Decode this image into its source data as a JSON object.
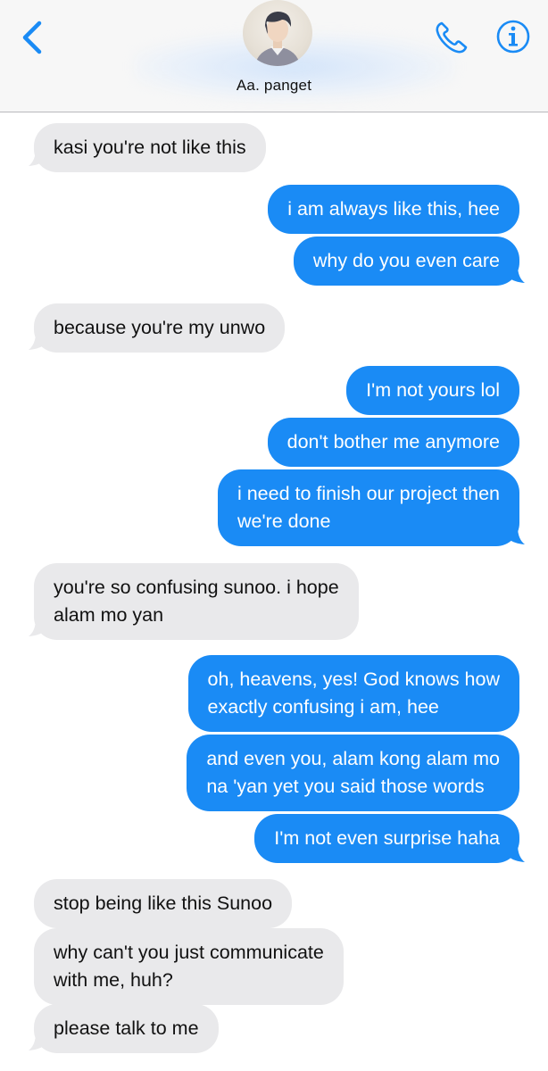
{
  "header": {
    "contact_name": "Aa. panget",
    "accent_color": "#1a8bf5",
    "icons": [
      "chevron-left-icon",
      "phone-icon",
      "info-icon"
    ]
  },
  "messages": [
    {
      "sender": "incoming",
      "lines": [
        "kasi you're not like this"
      ]
    },
    {
      "sender": "outgoing",
      "lines": [
        "i am always like this, hee"
      ]
    },
    {
      "sender": "outgoing",
      "lines": [
        "why do you even care"
      ]
    },
    {
      "sender": "incoming",
      "lines": [
        "because you're my unwo"
      ]
    },
    {
      "sender": "outgoing",
      "lines": [
        "I'm not yours lol"
      ]
    },
    {
      "sender": "outgoing",
      "lines": [
        "don't bother me anymore"
      ]
    },
    {
      "sender": "outgoing",
      "lines": [
        "i need to finish our project then",
        "we're done"
      ]
    },
    {
      "sender": "incoming",
      "lines": [
        "you're so confusing sunoo. i hope",
        "alam mo yan"
      ]
    },
    {
      "sender": "outgoing",
      "lines": [
        "oh, heavens, yes! God knows how",
        "exactly confusing i am, hee"
      ]
    },
    {
      "sender": "outgoing",
      "lines": [
        "and even you, alam kong alam mo",
        "na 'yan yet you said those words"
      ]
    },
    {
      "sender": "outgoing",
      "lines": [
        "I'm not even surprise haha"
      ]
    },
    {
      "sender": "incoming",
      "lines": [
        "stop being like this Sunoo"
      ]
    },
    {
      "sender": "incoming",
      "lines": [
        "why can't you just communicate",
        "with me, huh?"
      ]
    },
    {
      "sender": "incoming",
      "lines": [
        "please talk to me"
      ]
    }
  ]
}
